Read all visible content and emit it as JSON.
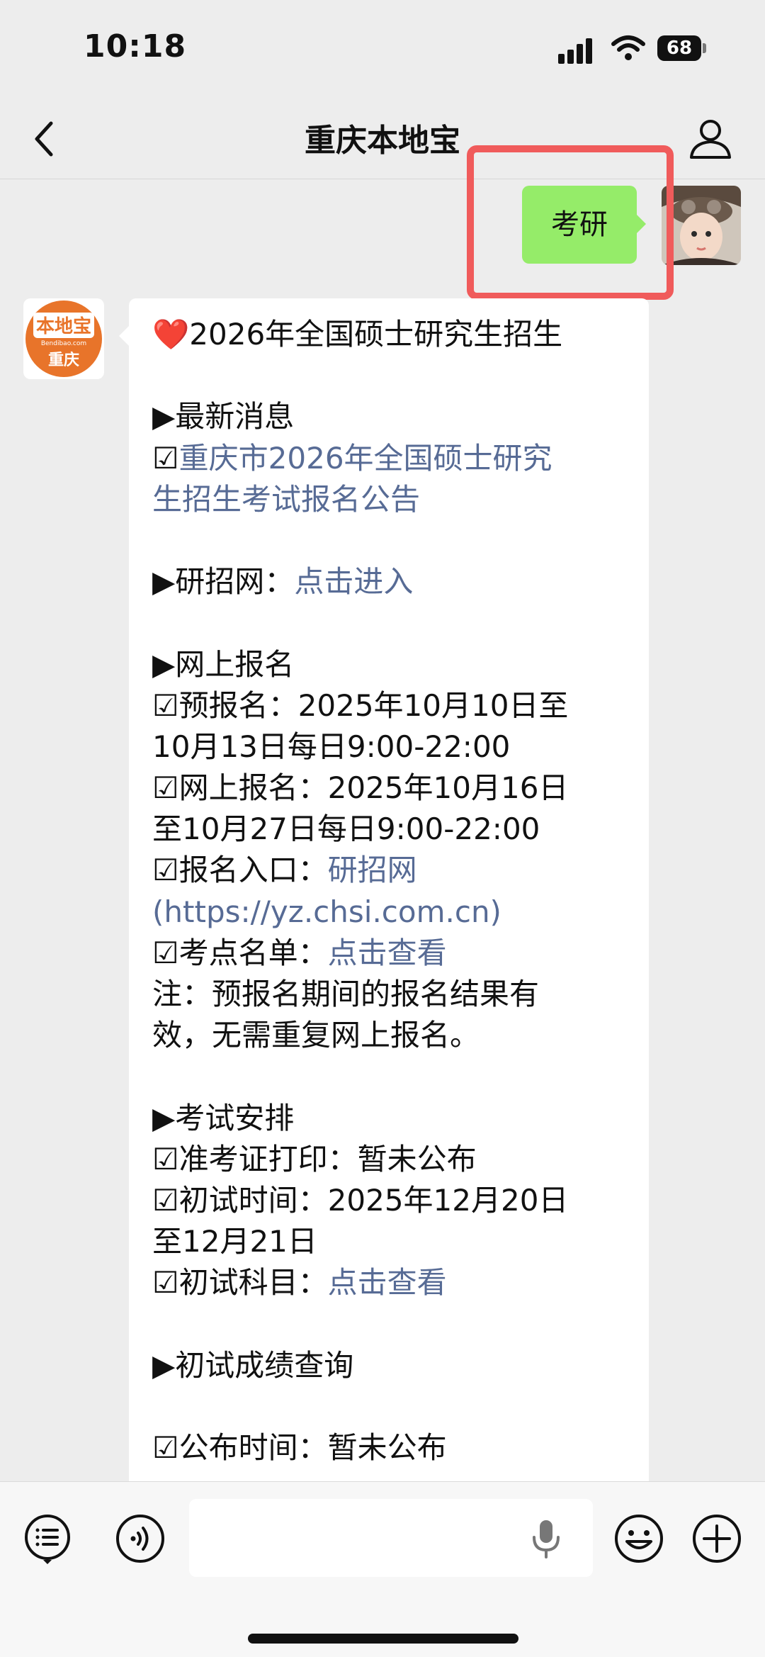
{
  "status_bar": {
    "time": "10:18",
    "battery": "68"
  },
  "nav": {
    "title": "重庆本地宝"
  },
  "sent_message": {
    "text": "考研"
  },
  "bot_avatar": {
    "line1": "本地宝",
    "line2": "Bendibao.com",
    "line3": "重庆"
  },
  "message": {
    "heart": "❤️",
    "title": "2026年全国硕士研究生招生",
    "sec1_header": "▶最新消息",
    "item1_box": "☑",
    "item1_link_line1": "重庆市2026年全国硕士研究",
    "item1_link_line2": "生招生考试报名公告",
    "sec2_label": "▶研招网：",
    "sec2_link": "点击进入",
    "sec3_header": "▶网上报名",
    "pre_reg_line1": "☑预报名：2025年10月10日至",
    "pre_reg_line2": "10月13日每日9:00-22:00",
    "online_reg_line1": "☑网上报名：2025年10月16日",
    "online_reg_line2": "至10月27日每日9:00-22:00",
    "entry_label": "☑报名入口：",
    "entry_link": "研招网",
    "entry_url": "(https://yz.chsi.com.cn)",
    "sites_label": "☑考点名单：",
    "sites_link": "点击查看",
    "note_line1": "注：预报名期间的报名结果有",
    "note_line2": "效，无需重复网上报名。",
    "sec4_header": "▶考试安排",
    "admit_line": "☑准考证打印：暂未公布",
    "exam_time_line1": "☑初试时间：2025年12月20日",
    "exam_time_line2": "至12月21日",
    "subjects_label": "☑初试科目：",
    "subjects_link": "点击查看",
    "sec5_header": "▶初试成绩查询",
    "publish_line": "☑公布时间：暂未公布"
  }
}
